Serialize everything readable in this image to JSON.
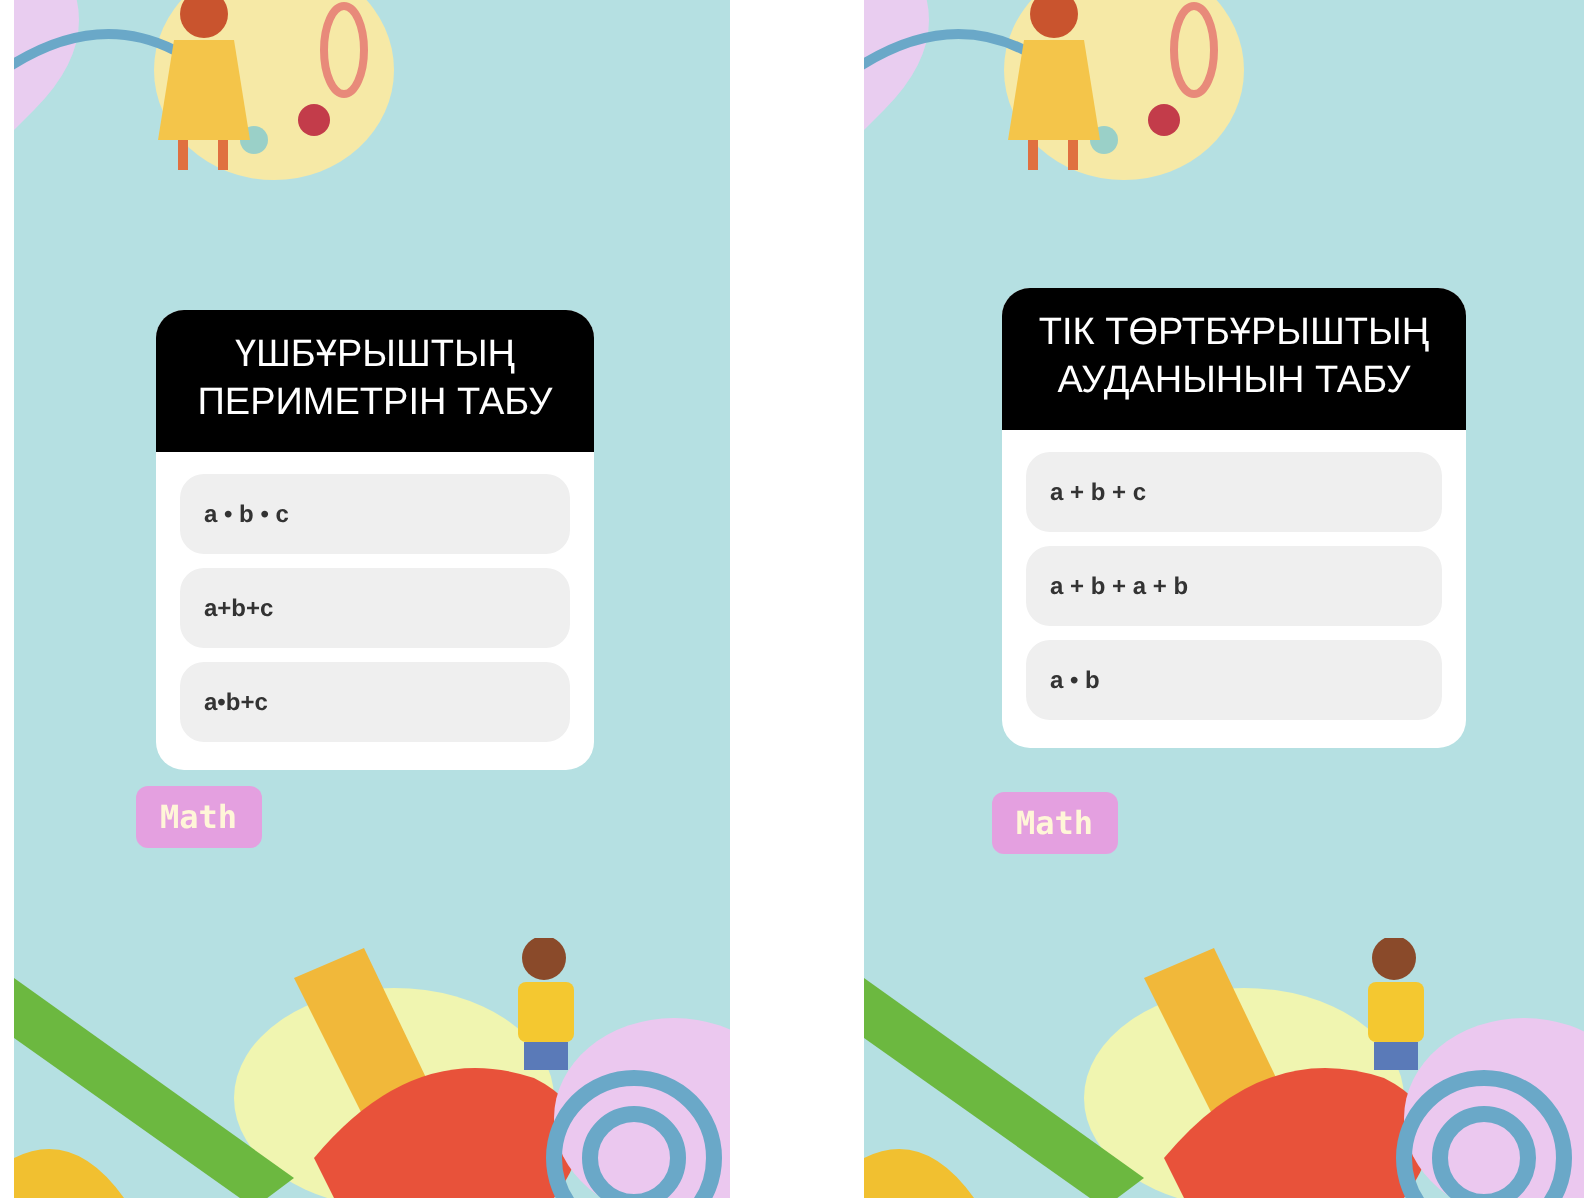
{
  "stories": [
    {
      "quiz": {
        "title": "ҮШБҰРЫШТЫҢ ПЕРИМЕТРІН ТАБУ",
        "options": [
          "a • b • c",
          "a+b+c",
          "a•b+c"
        ]
      },
      "tag": "Math"
    },
    {
      "quiz": {
        "title": "ТІК ТӨРТБҰРЫШТЫҢ АУДАНЫНЫН ТАБУ",
        "options": [
          "a + b + c",
          "a + b + a + b",
          "a • b"
        ]
      },
      "tag": "Math"
    }
  ]
}
